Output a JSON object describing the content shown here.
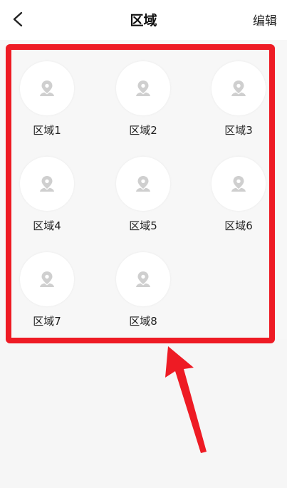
{
  "header": {
    "title": "区域",
    "edit_label": "编辑"
  },
  "areas": [
    {
      "label": "区域1"
    },
    {
      "label": "区域2"
    },
    {
      "label": "区域3"
    },
    {
      "label": "区域4"
    },
    {
      "label": "区域5"
    },
    {
      "label": "区域6"
    },
    {
      "label": "区域7"
    },
    {
      "label": "区域8"
    }
  ],
  "icons": {
    "back": "chevron-left-icon",
    "area": "location-person-icon"
  },
  "colors": {
    "highlight": "#ee1b24",
    "icon": "#cfcfcf",
    "background": "#f6f6f6"
  }
}
